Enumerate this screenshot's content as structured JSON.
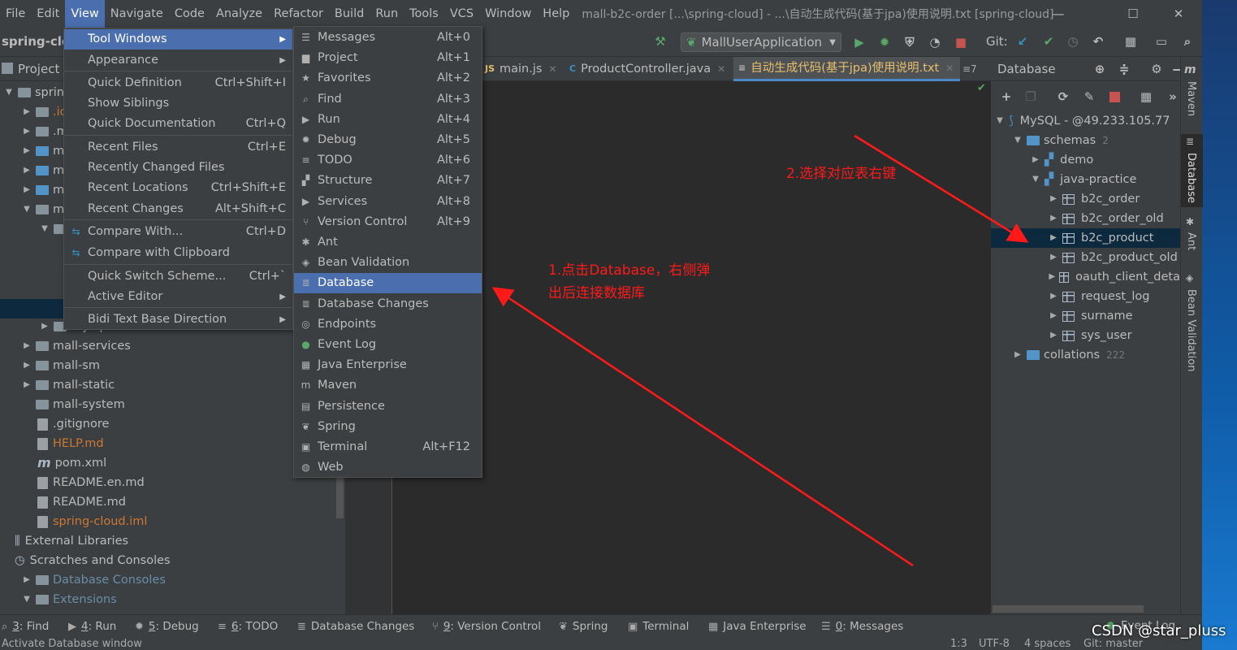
{
  "menubar": {
    "items": [
      "File",
      "Edit",
      "View",
      "Navigate",
      "Code",
      "Analyze",
      "Refactor",
      "Build",
      "Run",
      "Tools",
      "VCS",
      "Window",
      "Help"
    ],
    "window_title": "mall-b2c-order [...\\spring-cloud] - ...\\自动生成代码(基于jpa)使用说明.txt [spring-cloud]"
  },
  "toolbar": {
    "project_label": "spring-clou",
    "run_config": "MallUserApplication",
    "git_label": "Git:"
  },
  "project": {
    "header": "Project",
    "tree": [
      {
        "label": "spring",
        "arrow": "▼",
        "indent": 0,
        "type": "folder"
      },
      {
        "label": ".ide",
        "arrow": "▶",
        "indent": 1,
        "type": "folder",
        "color": "#cc7832"
      },
      {
        "label": ".mv",
        "arrow": "▶",
        "indent": 1,
        "type": "folder"
      },
      {
        "label": "ma",
        "arrow": "▶",
        "indent": 1,
        "type": "module"
      },
      {
        "label": "ma",
        "arrow": "▶",
        "indent": 1,
        "type": "module"
      },
      {
        "label": "ma",
        "arrow": "▶",
        "indent": 1,
        "type": "module"
      },
      {
        "label": "ma",
        "arrow": "▼",
        "indent": 1,
        "type": "folder"
      },
      {
        "label": "",
        "arrow": "▼",
        "indent": 2,
        "type": "folder"
      }
    ],
    "tree_lower": [
      {
        "label": "mysql",
        "arrow": "▶",
        "indent": 2,
        "type": "folder"
      },
      {
        "label": "mall-services",
        "arrow": "▶",
        "indent": 1,
        "type": "folder"
      },
      {
        "label": "mall-sm",
        "arrow": "▶",
        "indent": 1,
        "type": "folder"
      },
      {
        "label": "mall-static",
        "arrow": "▶",
        "indent": 1,
        "type": "folder"
      },
      {
        "label": "mall-system",
        "arrow": "",
        "indent": 1,
        "type": "folder"
      },
      {
        "label": ".gitignore",
        "arrow": "",
        "indent": 1,
        "type": "file"
      },
      {
        "label": "HELP.md",
        "arrow": "",
        "indent": 1,
        "type": "file",
        "color": "#cc7832"
      },
      {
        "label": "pom.xml",
        "arrow": "",
        "indent": 1,
        "type": "maven"
      },
      {
        "label": "README.en.md",
        "arrow": "",
        "indent": 1,
        "type": "file"
      },
      {
        "label": "README.md",
        "arrow": "",
        "indent": 1,
        "type": "file"
      },
      {
        "label": "spring-cloud.iml",
        "arrow": "",
        "indent": 1,
        "type": "file",
        "color": "#cc7832"
      },
      {
        "label": "External Libraries",
        "arrow": "",
        "indent": 0,
        "type": "lib"
      },
      {
        "label": "Scratches and Consoles",
        "arrow": "",
        "indent": 0,
        "type": "scratch"
      },
      {
        "label": "Database Consoles",
        "arrow": "▶",
        "indent": 1,
        "type": "folder",
        "color": "#6a8ca6"
      },
      {
        "label": "Extensions",
        "arrow": "▼",
        "indent": 1,
        "type": "folder",
        "color": "#6a8ca6"
      }
    ]
  },
  "tabs": [
    {
      "label": "main.js"
    },
    {
      "label": "ProductController.java"
    },
    {
      "label": "自动生成代码(基于jpa)使用说明.txt"
    }
  ],
  "tab_count": "≡7",
  "view_menu": {
    "items": [
      {
        "label": "Tool Windows",
        "shortcut": "",
        "submenu": true,
        "selected": true
      },
      {
        "label": "Appearance",
        "shortcut": "",
        "submenu": true
      },
      {
        "label": "Quick Definition",
        "shortcut": "Ctrl+Shift+I",
        "sep": true
      },
      {
        "label": "Show Siblings",
        "shortcut": ""
      },
      {
        "label": "Quick Documentation",
        "shortcut": "Ctrl+Q"
      },
      {
        "label": "Recent Files",
        "shortcut": "Ctrl+E",
        "sep": true
      },
      {
        "label": "Recently Changed Files",
        "shortcut": ""
      },
      {
        "label": "Recent Locations",
        "shortcut": "Ctrl+Shift+E"
      },
      {
        "label": "Recent Changes",
        "shortcut": "Alt+Shift+C"
      },
      {
        "label": "Compare With...",
        "shortcut": "Ctrl+D",
        "sep": true,
        "icon": "compare-icon"
      },
      {
        "label": "Compare with Clipboard",
        "shortcut": "",
        "icon": "clipboard-compare-icon"
      },
      {
        "label": "Quick Switch Scheme...",
        "shortcut": "Ctrl+`",
        "sep": true
      },
      {
        "label": "Active Editor",
        "shortcut": "",
        "submenu": true
      },
      {
        "label": "Bidi Text Base Direction",
        "shortcut": "",
        "submenu": true,
        "sep": true
      }
    ]
  },
  "tool_windows_menu": {
    "items": [
      {
        "label": "Messages",
        "shortcut": "Alt+0",
        "icon": "messages-icon",
        "glyph": "☰"
      },
      {
        "label": "Project",
        "shortcut": "Alt+1",
        "icon": "project-icon",
        "glyph": "▆"
      },
      {
        "label": "Favorites",
        "shortcut": "Alt+2",
        "icon": "star-icon",
        "glyph": "★"
      },
      {
        "label": "Find",
        "shortcut": "Alt+3",
        "icon": "search-icon",
        "glyph": "⌕"
      },
      {
        "label": "Run",
        "shortcut": "Alt+4",
        "icon": "run-icon",
        "glyph": "▶"
      },
      {
        "label": "Debug",
        "shortcut": "Alt+5",
        "icon": "debug-icon",
        "glyph": "✹"
      },
      {
        "label": "TODO",
        "shortcut": "Alt+6",
        "icon": "todo-icon",
        "glyph": "≡"
      },
      {
        "label": "Structure",
        "shortcut": "Alt+7",
        "icon": "structure-icon",
        "glyph": "▞"
      },
      {
        "label": "Services",
        "shortcut": "Alt+8",
        "icon": "services-icon",
        "glyph": "▶"
      },
      {
        "label": "Version Control",
        "shortcut": "Alt+9",
        "icon": "vcs-icon",
        "glyph": "⑂"
      },
      {
        "label": "Ant",
        "shortcut": "",
        "icon": "ant-icon",
        "glyph": "✱"
      },
      {
        "label": "Bean Validation",
        "shortcut": "",
        "icon": "bean-validation-icon",
        "glyph": "◈"
      },
      {
        "label": "Database",
        "shortcut": "",
        "icon": "database-icon",
        "glyph": "≣",
        "selected": true
      },
      {
        "label": "Database Changes",
        "shortcut": "",
        "icon": "database-changes-icon",
        "glyph": "≣"
      },
      {
        "label": "Endpoints",
        "shortcut": "",
        "icon": "endpoints-icon",
        "glyph": "◎"
      },
      {
        "label": "Event Log",
        "shortcut": "",
        "icon": "event-log-icon",
        "glyph": "●"
      },
      {
        "label": "Java Enterprise",
        "shortcut": "",
        "icon": "java-enterprise-icon",
        "glyph": "▦"
      },
      {
        "label": "Maven",
        "shortcut": "",
        "icon": "maven-icon",
        "glyph": "m"
      },
      {
        "label": "Persistence",
        "shortcut": "",
        "icon": "persistence-icon",
        "glyph": "▤"
      },
      {
        "label": "Spring",
        "shortcut": "",
        "icon": "spring-icon",
        "glyph": "❦"
      },
      {
        "label": "Terminal",
        "shortcut": "Alt+F12",
        "icon": "terminal-icon",
        "glyph": "▣"
      },
      {
        "label": "Web",
        "shortcut": "",
        "icon": "web-icon",
        "glyph": "◍"
      }
    ]
  },
  "database": {
    "header": "Database",
    "tree": [
      {
        "label": "MySQL - @49.233.105.77",
        "arrow": "▼",
        "indent": 0,
        "type": "datasource"
      },
      {
        "label": "schemas",
        "count": "2",
        "arrow": "▼",
        "indent": 1,
        "type": "folder"
      },
      {
        "label": "demo",
        "arrow": "▶",
        "indent": 2,
        "type": "schema"
      },
      {
        "label": "java-practice",
        "arrow": "▼",
        "indent": 2,
        "type": "schema"
      },
      {
        "label": "b2c_order",
        "arrow": "▶",
        "indent": 3,
        "type": "table"
      },
      {
        "label": "b2c_order_old",
        "arrow": "▶",
        "indent": 3,
        "type": "table"
      },
      {
        "label": "b2c_product",
        "arrow": "▶",
        "indent": 3,
        "type": "table",
        "selected": true
      },
      {
        "label": "b2c_product_old",
        "arrow": "▶",
        "indent": 3,
        "type": "table"
      },
      {
        "label": "oauth_client_deta",
        "arrow": "▶",
        "indent": 3,
        "type": "table"
      },
      {
        "label": "request_log",
        "arrow": "▶",
        "indent": 3,
        "type": "table"
      },
      {
        "label": "surname",
        "arrow": "▶",
        "indent": 3,
        "type": "table"
      },
      {
        "label": "sys_user",
        "arrow": "▶",
        "indent": 3,
        "type": "table"
      },
      {
        "label": "collations",
        "count": "222",
        "arrow": "▶",
        "indent": 1,
        "type": "folder"
      }
    ]
  },
  "right_strip": [
    "Maven",
    "Database",
    "Ant",
    "Bean Validation"
  ],
  "statusbar": {
    "items": [
      {
        "key": "3",
        "label": ": Find",
        "icon": "search-icon",
        "glyph": "⌕"
      },
      {
        "key": "4",
        "label": ": Run",
        "icon": "run-icon",
        "glyph": "▶"
      },
      {
        "key": "5",
        "label": ": Debug",
        "icon": "debug-icon",
        "glyph": "✹"
      },
      {
        "key": "6",
        "label": ": TODO",
        "icon": "todo-icon",
        "glyph": "≡"
      },
      {
        "key": "",
        "label": "Database Changes",
        "icon": "database-changes-icon",
        "glyph": "≣"
      },
      {
        "key": "9",
        "label": ": Version Control",
        "icon": "vcs-icon",
        "glyph": "⑂"
      },
      {
        "key": "",
        "label": "Spring",
        "icon": "spring-icon",
        "glyph": "❦"
      },
      {
        "key": "",
        "label": "Terminal",
        "icon": "terminal-icon",
        "glyph": "▣"
      },
      {
        "key": "",
        "label": "Java Enterprise",
        "icon": "java-enterprise-icon",
        "glyph": "▦"
      },
      {
        "key": "0",
        "label": ": Messages",
        "icon": "messages-icon",
        "glyph": "☰"
      }
    ],
    "event_log": "Event Log"
  },
  "bottom": {
    "hint": "Activate Database window",
    "position": "1:3",
    "encoding": "UTF-8",
    "indent": "4 spaces",
    "git": "Git: master"
  },
  "annotations": {
    "step1_line1": "1.点击Database，右侧弹",
    "step1_line2": "出后连接数据库",
    "step2": "2.选择对应表右键"
  },
  "watermark": "CSDN @star_pluss",
  "colors": {
    "accent": "#4b6eaf",
    "annotation": "#ff1a1a",
    "panel": "#3c3f41",
    "editor": "#2b2b2b"
  }
}
